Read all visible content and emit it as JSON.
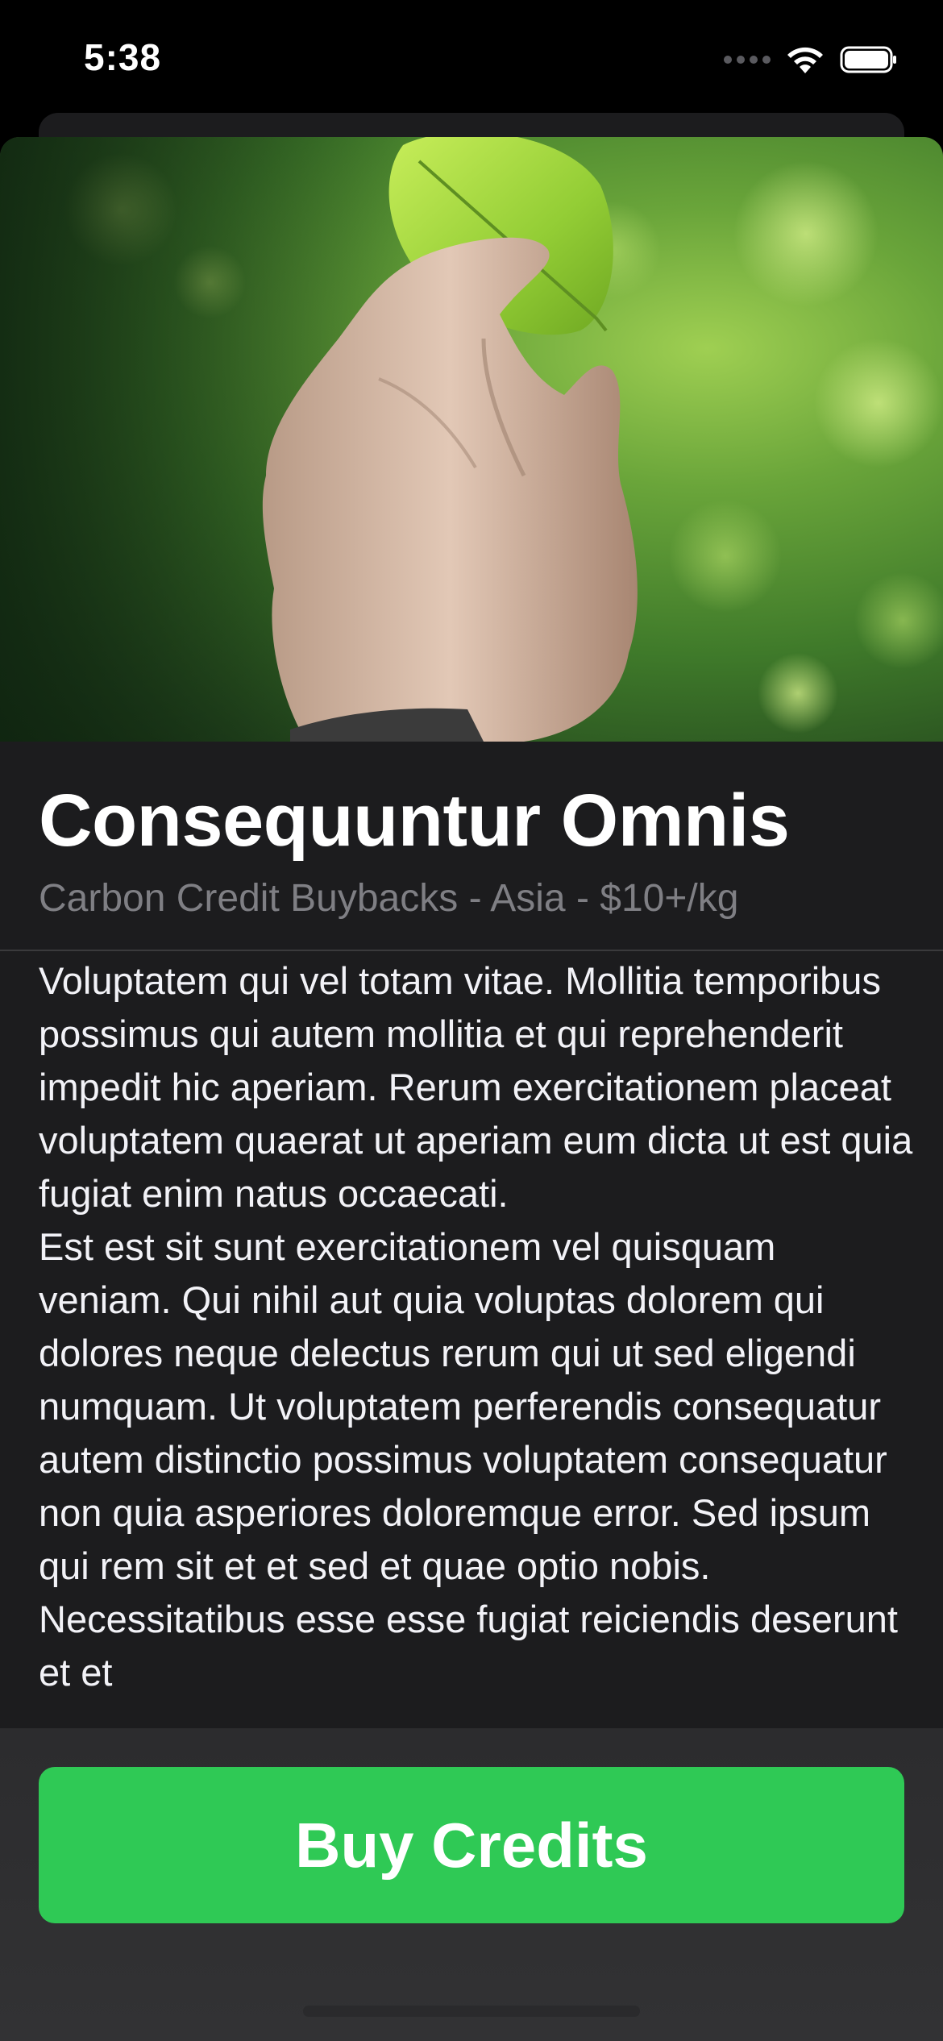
{
  "status_bar": {
    "time": "5:38",
    "icons": [
      "cellular-signal-icon",
      "wifi-icon",
      "battery-icon"
    ]
  },
  "project": {
    "hero_image": "hand-holding-leaf-photo",
    "title": "Consequuntur Omnis",
    "subtitle": "Carbon Credit Buybacks - Asia - $10+/kg",
    "description": [
      "Voluptatem qui vel totam vitae. Mollitia temporibus possimus qui autem mollitia et qui reprehenderit impedit hic aperiam. Rerum exercitationem placeat voluptatem quaerat ut aperiam eum dicta ut est quia fugiat enim natus occaecati.",
      "Est est sit sunt exercitationem vel quisquam veniam. Qui nihil aut quia voluptas dolorem qui dolores neque delectus rerum qui ut sed eligendi numquam. Ut voluptatem perferendis consequatur autem distinctio possimus voluptatem consequatur non quia asperiores doloremque error. Sed ipsum qui rem sit et et sed et quae optio nobis. Necessitatibus esse esse fugiat reiciendis deserunt et et"
    ]
  },
  "actions": {
    "buy_label": "Buy Credits"
  },
  "colors": {
    "background": "#000000",
    "card": "#1c1c1e",
    "accent_green": "#2fc955",
    "subtitle_gray": "#7f7f84"
  }
}
